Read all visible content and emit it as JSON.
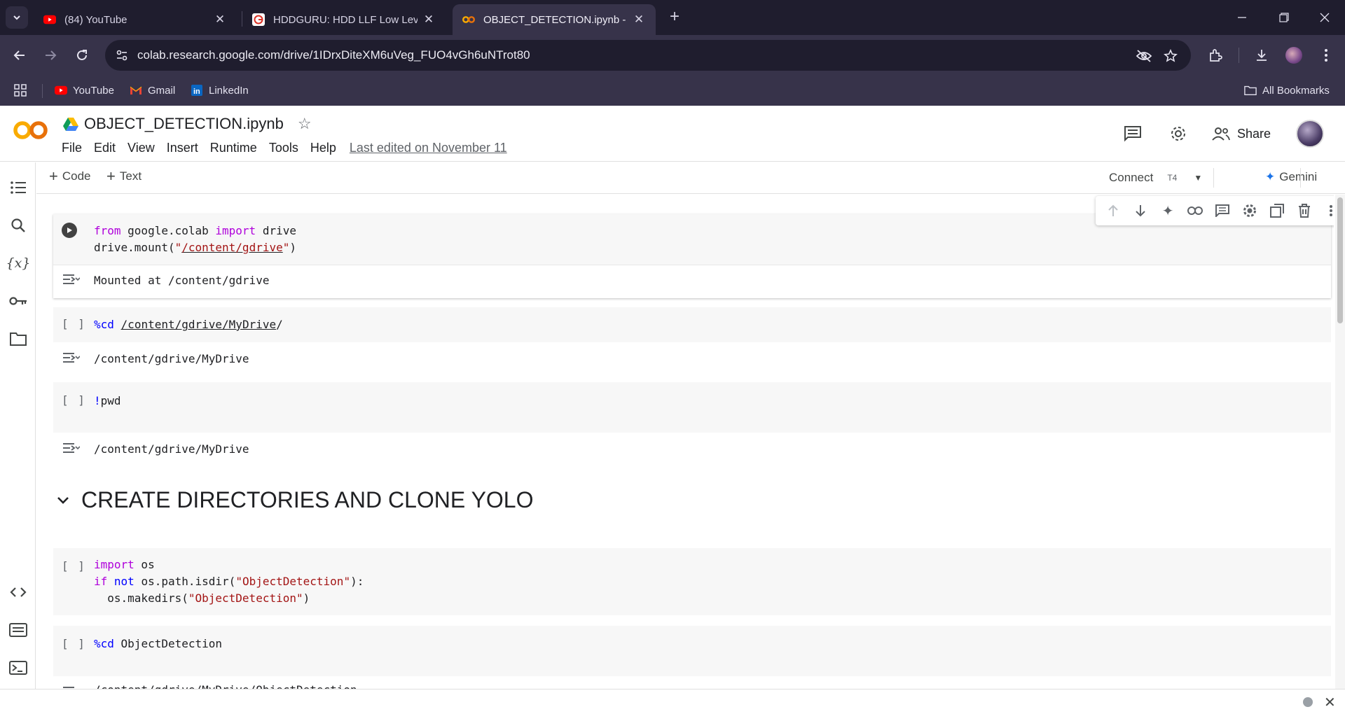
{
  "browser": {
    "tabs": [
      {
        "title": "(84) YouTube",
        "icon": "youtube-icon",
        "active": false
      },
      {
        "title": "HDDGURU: HDD LLF Low Level",
        "icon": "hddguru-icon",
        "active": false
      },
      {
        "title": "OBJECT_DETECTION.ipynb - Col",
        "icon": "colab-icon",
        "active": true
      }
    ],
    "url": "colab.research.google.com/drive/1IDrxDiteXM6uVeg_FUO4vGh6uNTrot80",
    "bookmarks": [
      {
        "label": "YouTube",
        "icon": "youtube-icon"
      },
      {
        "label": "Gmail",
        "icon": "gmail-icon"
      },
      {
        "label": "LinkedIn",
        "icon": "linkedin-icon"
      }
    ],
    "all_bookmarks": "All Bookmarks"
  },
  "colab": {
    "notebook_name": "OBJECT_DETECTION.ipynb",
    "menu": [
      "File",
      "Edit",
      "View",
      "Insert",
      "Runtime",
      "Tools",
      "Help"
    ],
    "last_edited": "Last edited on November 11",
    "share_label": "Share",
    "add_code": "Code",
    "add_text": "Text",
    "connect_label": "Connect",
    "runtime_type": "T4",
    "gemini_label": "Gemini"
  },
  "cells": {
    "c1_output": "Mounted at /content/gdrive",
    "c2_output": "/content/gdrive/MyDrive",
    "c3_output": "/content/gdrive/MyDrive",
    "section_heading": "CREATE DIRECTORIES AND CLONE YOLO",
    "c6_output": "/content/gdrive/MyDrive/ObjectDetection"
  },
  "colors": {
    "keyword": "#af00db",
    "magic": "#0000ff",
    "string": "#a31515",
    "colab_orange": "#f9ab00"
  }
}
